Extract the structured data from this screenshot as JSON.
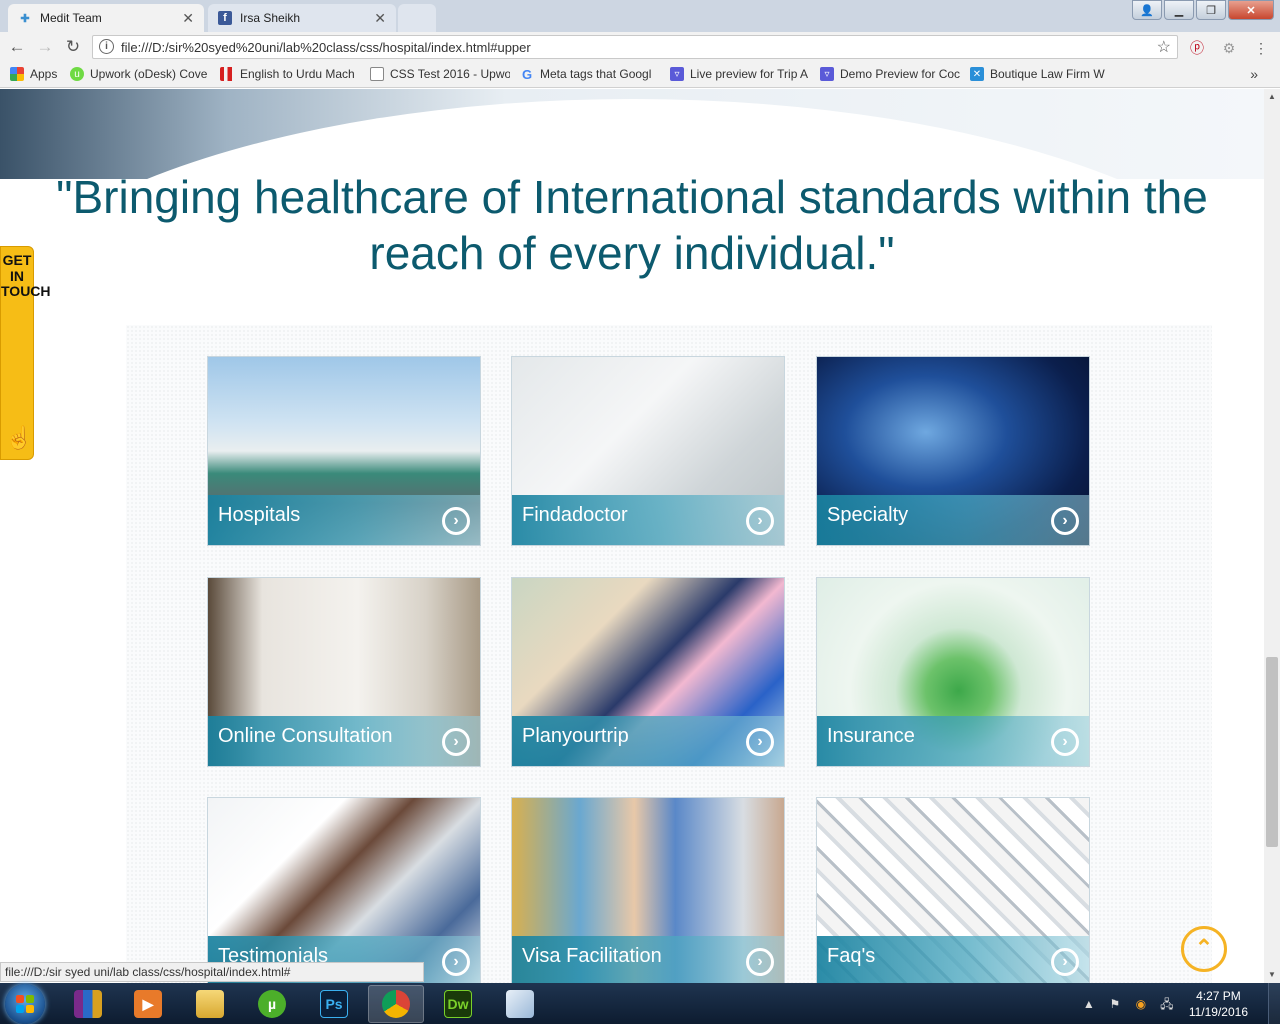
{
  "browser": {
    "tabs": [
      {
        "title": "Medit Team",
        "icon": "medical-cross-icon",
        "active": true
      },
      {
        "title": "Irsa Sheikh",
        "icon": "facebook-icon",
        "active": false
      }
    ],
    "address": "file:///D:/sir%20syed%20uni/lab%20class/css/hospital/index.html#upper",
    "bookmarks": [
      {
        "label": "Apps",
        "icon": "apps-grid-icon"
      },
      {
        "label": "Upwork (oDesk) Cove",
        "icon": "upwork-icon"
      },
      {
        "label": "English to Urdu Mach",
        "icon": "bookmark-red-icon"
      },
      {
        "label": "CSS Test 2016 - Upwo",
        "icon": "page-icon"
      },
      {
        "label": "Meta tags that Googl",
        "icon": "google-icon"
      },
      {
        "label": "Live preview for Trip A",
        "icon": "themeforest-icon"
      },
      {
        "label": "Demo Preview for Coc",
        "icon": "themeforest-icon"
      },
      {
        "label": "Boutique Law Firm W",
        "icon": "x-logo-icon"
      }
    ],
    "status_url": "file:///D:/sir syed uni/lab class/css/hospital/index.html#"
  },
  "page": {
    "quote_line1": "\"Bringing healthcare of International standards within the",
    "quote_line2": "reach of every individual.\"",
    "get_in_touch": "GET\nIN\nTOUCH",
    "services": [
      {
        "label": "Hospitals"
      },
      {
        "label": "Findadoctor"
      },
      {
        "label": "Specialty"
      },
      {
        "label": "Online Consultation"
      },
      {
        "label": "Planyourtrip"
      },
      {
        "label": "Insurance"
      },
      {
        "label": "Testimonials"
      },
      {
        "label": "Visa Facilitation"
      },
      {
        "label": "Faq's"
      }
    ]
  },
  "taskbar": {
    "apps": [
      "winrar-icon",
      "media-player-icon",
      "file-explorer-icon",
      "utorrent-icon",
      "photoshop-icon",
      "chrome-icon",
      "dreamweaver-icon",
      "notepad-icon"
    ],
    "ps_label": "Ps",
    "dw_label": "Dw",
    "time": "4:27 PM",
    "date": "11/19/2016"
  },
  "colors": {
    "quote": "#0c5a6e",
    "card_band": "#1982a0",
    "accent_yellow": "#f6bd16"
  }
}
